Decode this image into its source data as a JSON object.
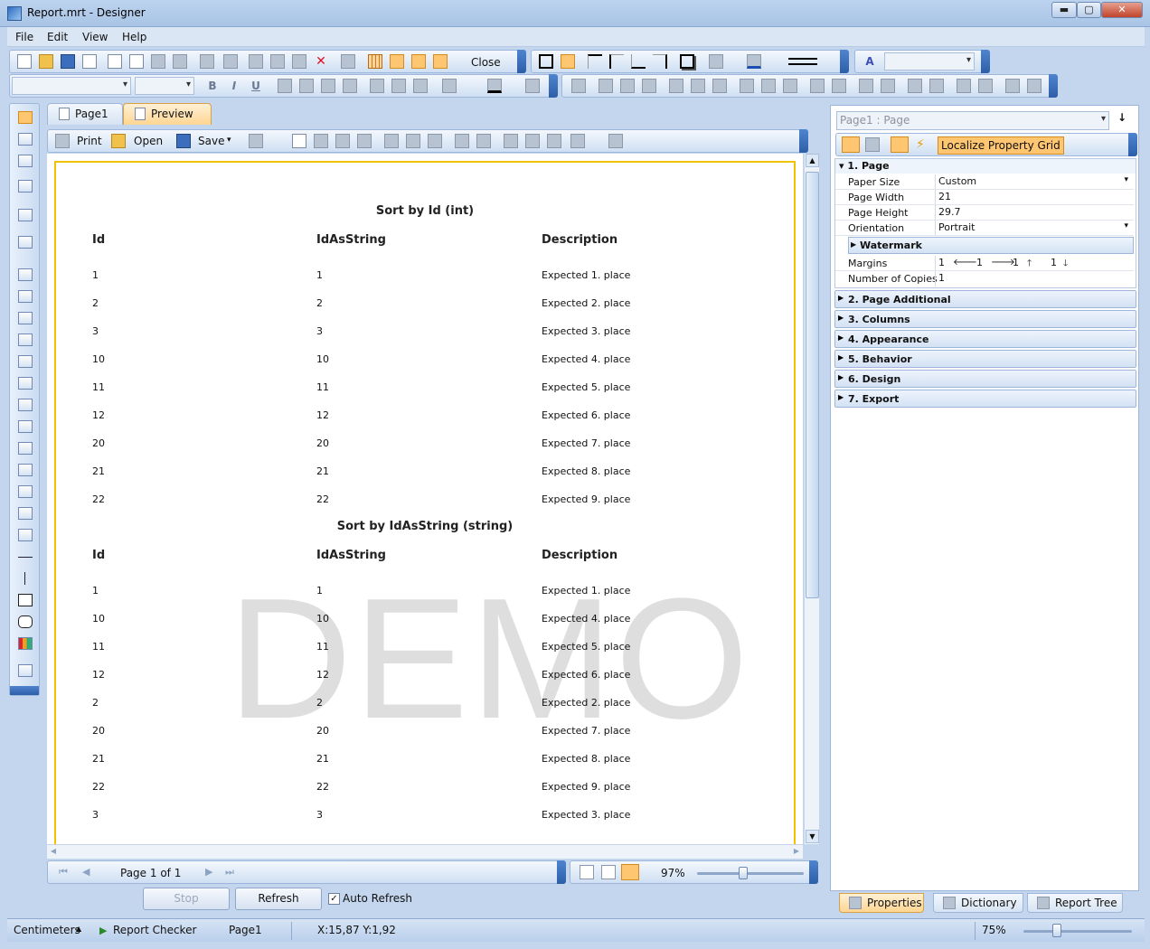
{
  "window": {
    "title": "Report.mrt - Designer",
    "min": "▬",
    "max": "▢",
    "close": "✕"
  },
  "menu": [
    "File",
    "Edit",
    "View",
    "Help"
  ],
  "toolbar": {
    "close_label": "Close",
    "localize_label": "Localize Property Grid"
  },
  "tabs": {
    "page1": "Page1",
    "preview": "Preview"
  },
  "preview_toolbar": {
    "print": "Print",
    "open": "Open",
    "save": "Save"
  },
  "report": {
    "section1": {
      "title": "Sort by Id (int)",
      "headers": [
        "Id",
        "IdAsString",
        "Description"
      ],
      "rows": [
        [
          "1",
          "1",
          "Expected 1. place"
        ],
        [
          "2",
          "2",
          "Expected 2. place"
        ],
        [
          "3",
          "3",
          "Expected 3. place"
        ],
        [
          "10",
          "10",
          "Expected 4. place"
        ],
        [
          "11",
          "11",
          "Expected 5. place"
        ],
        [
          "12",
          "12",
          "Expected 6. place"
        ],
        [
          "20",
          "20",
          "Expected 7. place"
        ],
        [
          "21",
          "21",
          "Expected 8. place"
        ],
        [
          "22",
          "22",
          "Expected 9. place"
        ]
      ]
    },
    "section2": {
      "title": "Sort by IdAsString (string)",
      "headers": [
        "Id",
        "IdAsString",
        "Description"
      ],
      "rows": [
        [
          "1",
          "1",
          "Expected 1. place"
        ],
        [
          "10",
          "10",
          "Expected 4. place"
        ],
        [
          "11",
          "11",
          "Expected 5. place"
        ],
        [
          "12",
          "12",
          "Expected 6. place"
        ],
        [
          "2",
          "2",
          "Expected 2. place"
        ],
        [
          "20",
          "20",
          "Expected 7. place"
        ],
        [
          "21",
          "21",
          "Expected 8. place"
        ],
        [
          "22",
          "22",
          "Expected 9. place"
        ],
        [
          "3",
          "3",
          "Expected 3. place"
        ]
      ]
    },
    "watermark": "DEMO"
  },
  "navigation": {
    "page_label": "Page 1 of 1",
    "zoom": "97%",
    "stop": "Stop",
    "refresh": "Refresh",
    "auto_refresh": "Auto Refresh",
    "auto_refresh_checked": true
  },
  "properties": {
    "object_selector": "Page1 : Page",
    "page_category": "1. Page",
    "rows": {
      "paper_size": {
        "name": "Paper Size",
        "value": "Custom"
      },
      "page_width": {
        "name": "Page Width",
        "value": "21"
      },
      "page_height": {
        "name": "Page Height",
        "value": "29.7"
      },
      "orientation": {
        "name": "Orientation",
        "value": "Portrait"
      },
      "watermark": {
        "name": "Watermark"
      },
      "margins": {
        "name": "Margins",
        "left": "1",
        "right": "1",
        "top": "1",
        "bottom": "1"
      },
      "copies": {
        "name": "Number of Copies",
        "value": "1"
      }
    },
    "categories": [
      "2. Page  Additional",
      "3. Columns",
      "4. Appearance",
      "5. Behavior",
      "6. Design",
      "7. Export"
    ],
    "tabs": [
      "Properties",
      "Dictionary",
      "Report Tree"
    ]
  },
  "status": {
    "units": "Centimeters",
    "checker": "Report Checker",
    "page": "Page1",
    "coords": "X:15,87  Y:1,92",
    "zoom": "75%"
  }
}
